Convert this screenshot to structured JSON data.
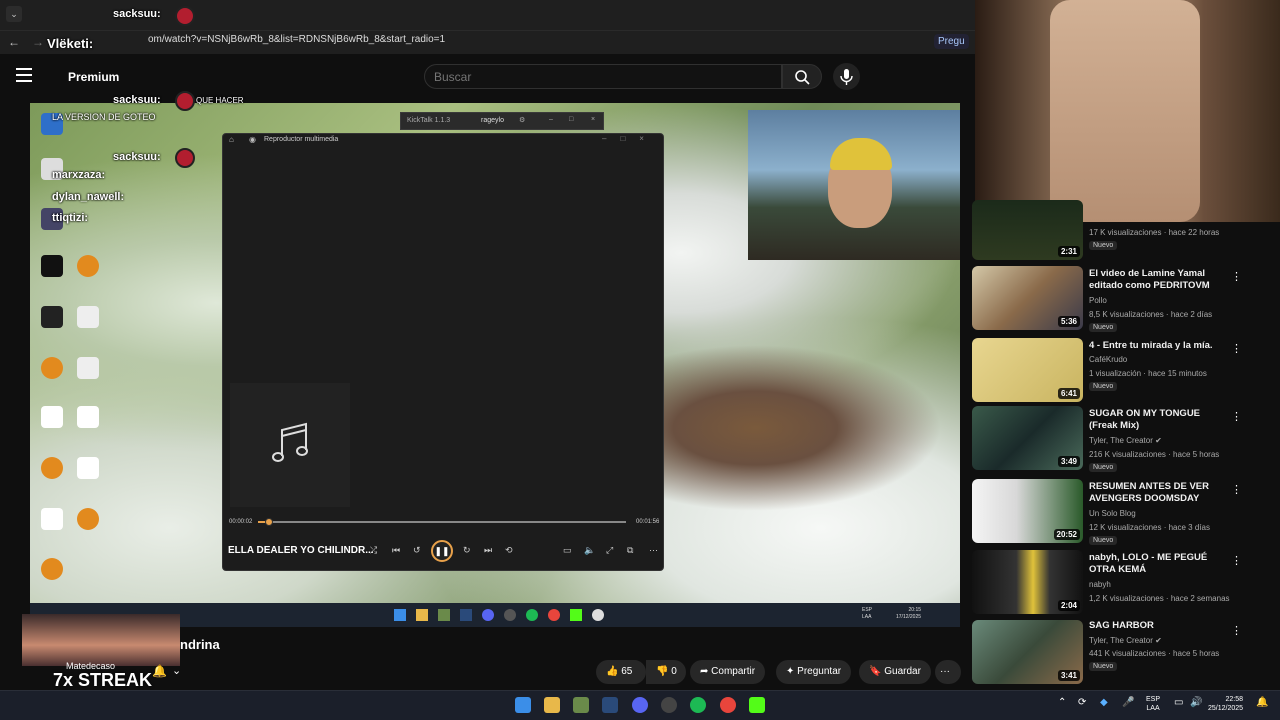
{
  "browser": {
    "url": "om/watch?v=NSNjB6wRb_8&list=RDNSNjB6wRb_8&start_radio=1",
    "premium_chip": "Pregu"
  },
  "youtube": {
    "logo": "Premium",
    "search_placeholder": "Buscar",
    "video_title": "ndrina",
    "actions": {
      "likes": "65",
      "dislikes": "0",
      "share": "Compartir",
      "ask": "Preguntar",
      "save": "Guardar",
      "more": "···"
    }
  },
  "media_player": {
    "window_title": "Reproductor multimedia",
    "song": "ELLA DEALER YO CHILINDR...",
    "time_current": "00:00:02",
    "time_total": "00:01:56",
    "progress_fraction": 0.03
  },
  "kicktalk": {
    "title": "KickTalk 1.1.3",
    "user": "rageylo"
  },
  "chat_overlay": {
    "lines": [
      "sacksuu:",
      "Vlëketi:",
      "marxzaza:",
      "dylan_nawell:",
      "ttiqtizi:",
      "sacksuu:",
      "sacksuu:"
    ],
    "streak": "7x STREAK",
    "streak_user": "Matedecaso",
    "desktop_text": "LA VERSION DE GOTEO",
    "top_text": "QUE HACER"
  },
  "inner_taskbar": {
    "lang": "ESP\nLAA",
    "clock": "20:15\n17/12/2025"
  },
  "recommendations": [
    {
      "title": "",
      "channel": "",
      "meta": "17 K visualizaciones · hace 22 horas",
      "badge": "Nuevo",
      "duration": "2:31"
    },
    {
      "title": "El video de Lamine Yamal editado como PEDRITOVM",
      "channel": "Pollo",
      "meta": "8,5 K visualizaciones · hace 2 días",
      "badge": "Nuevo",
      "duration": "5:36"
    },
    {
      "title": "4 - Entre tu mirada y la mía.",
      "channel": "CaféKrudo",
      "meta": "1 visualización · hace 15 minutos",
      "badge": "Nuevo",
      "duration": "6:41"
    },
    {
      "title": "SUGAR ON MY TONGUE (Freak Mix)",
      "channel": "Tyler, The Creator",
      "meta": "216 K visualizaciones · hace 5 horas",
      "badge": "Nuevo",
      "duration": "3:49"
    },
    {
      "title": "RESUMEN ANTES DE VER AVENGERS DOOMSDAY",
      "channel": "Un Solo Blog",
      "meta": "12 K visualizaciones · hace 3 días",
      "badge": "Nuevo",
      "duration": "20:52"
    },
    {
      "title": "nabyh, LOLO - ME PEGUÉ OTRA KEMÁ",
      "channel": "nabyh",
      "meta": "1,2 K visualizaciones · hace 2 semanas",
      "badge": "",
      "duration": "2:04"
    },
    {
      "title": "SAG HARBOR",
      "channel": "Tyler, The Creator",
      "meta": "441 K visualizaciones · hace 5 horas",
      "badge": "Nuevo",
      "duration": "3:41"
    }
  ],
  "taskbar": {
    "lang": "ESP\nLAA",
    "time": "22:58",
    "date": "25/12/2025"
  }
}
